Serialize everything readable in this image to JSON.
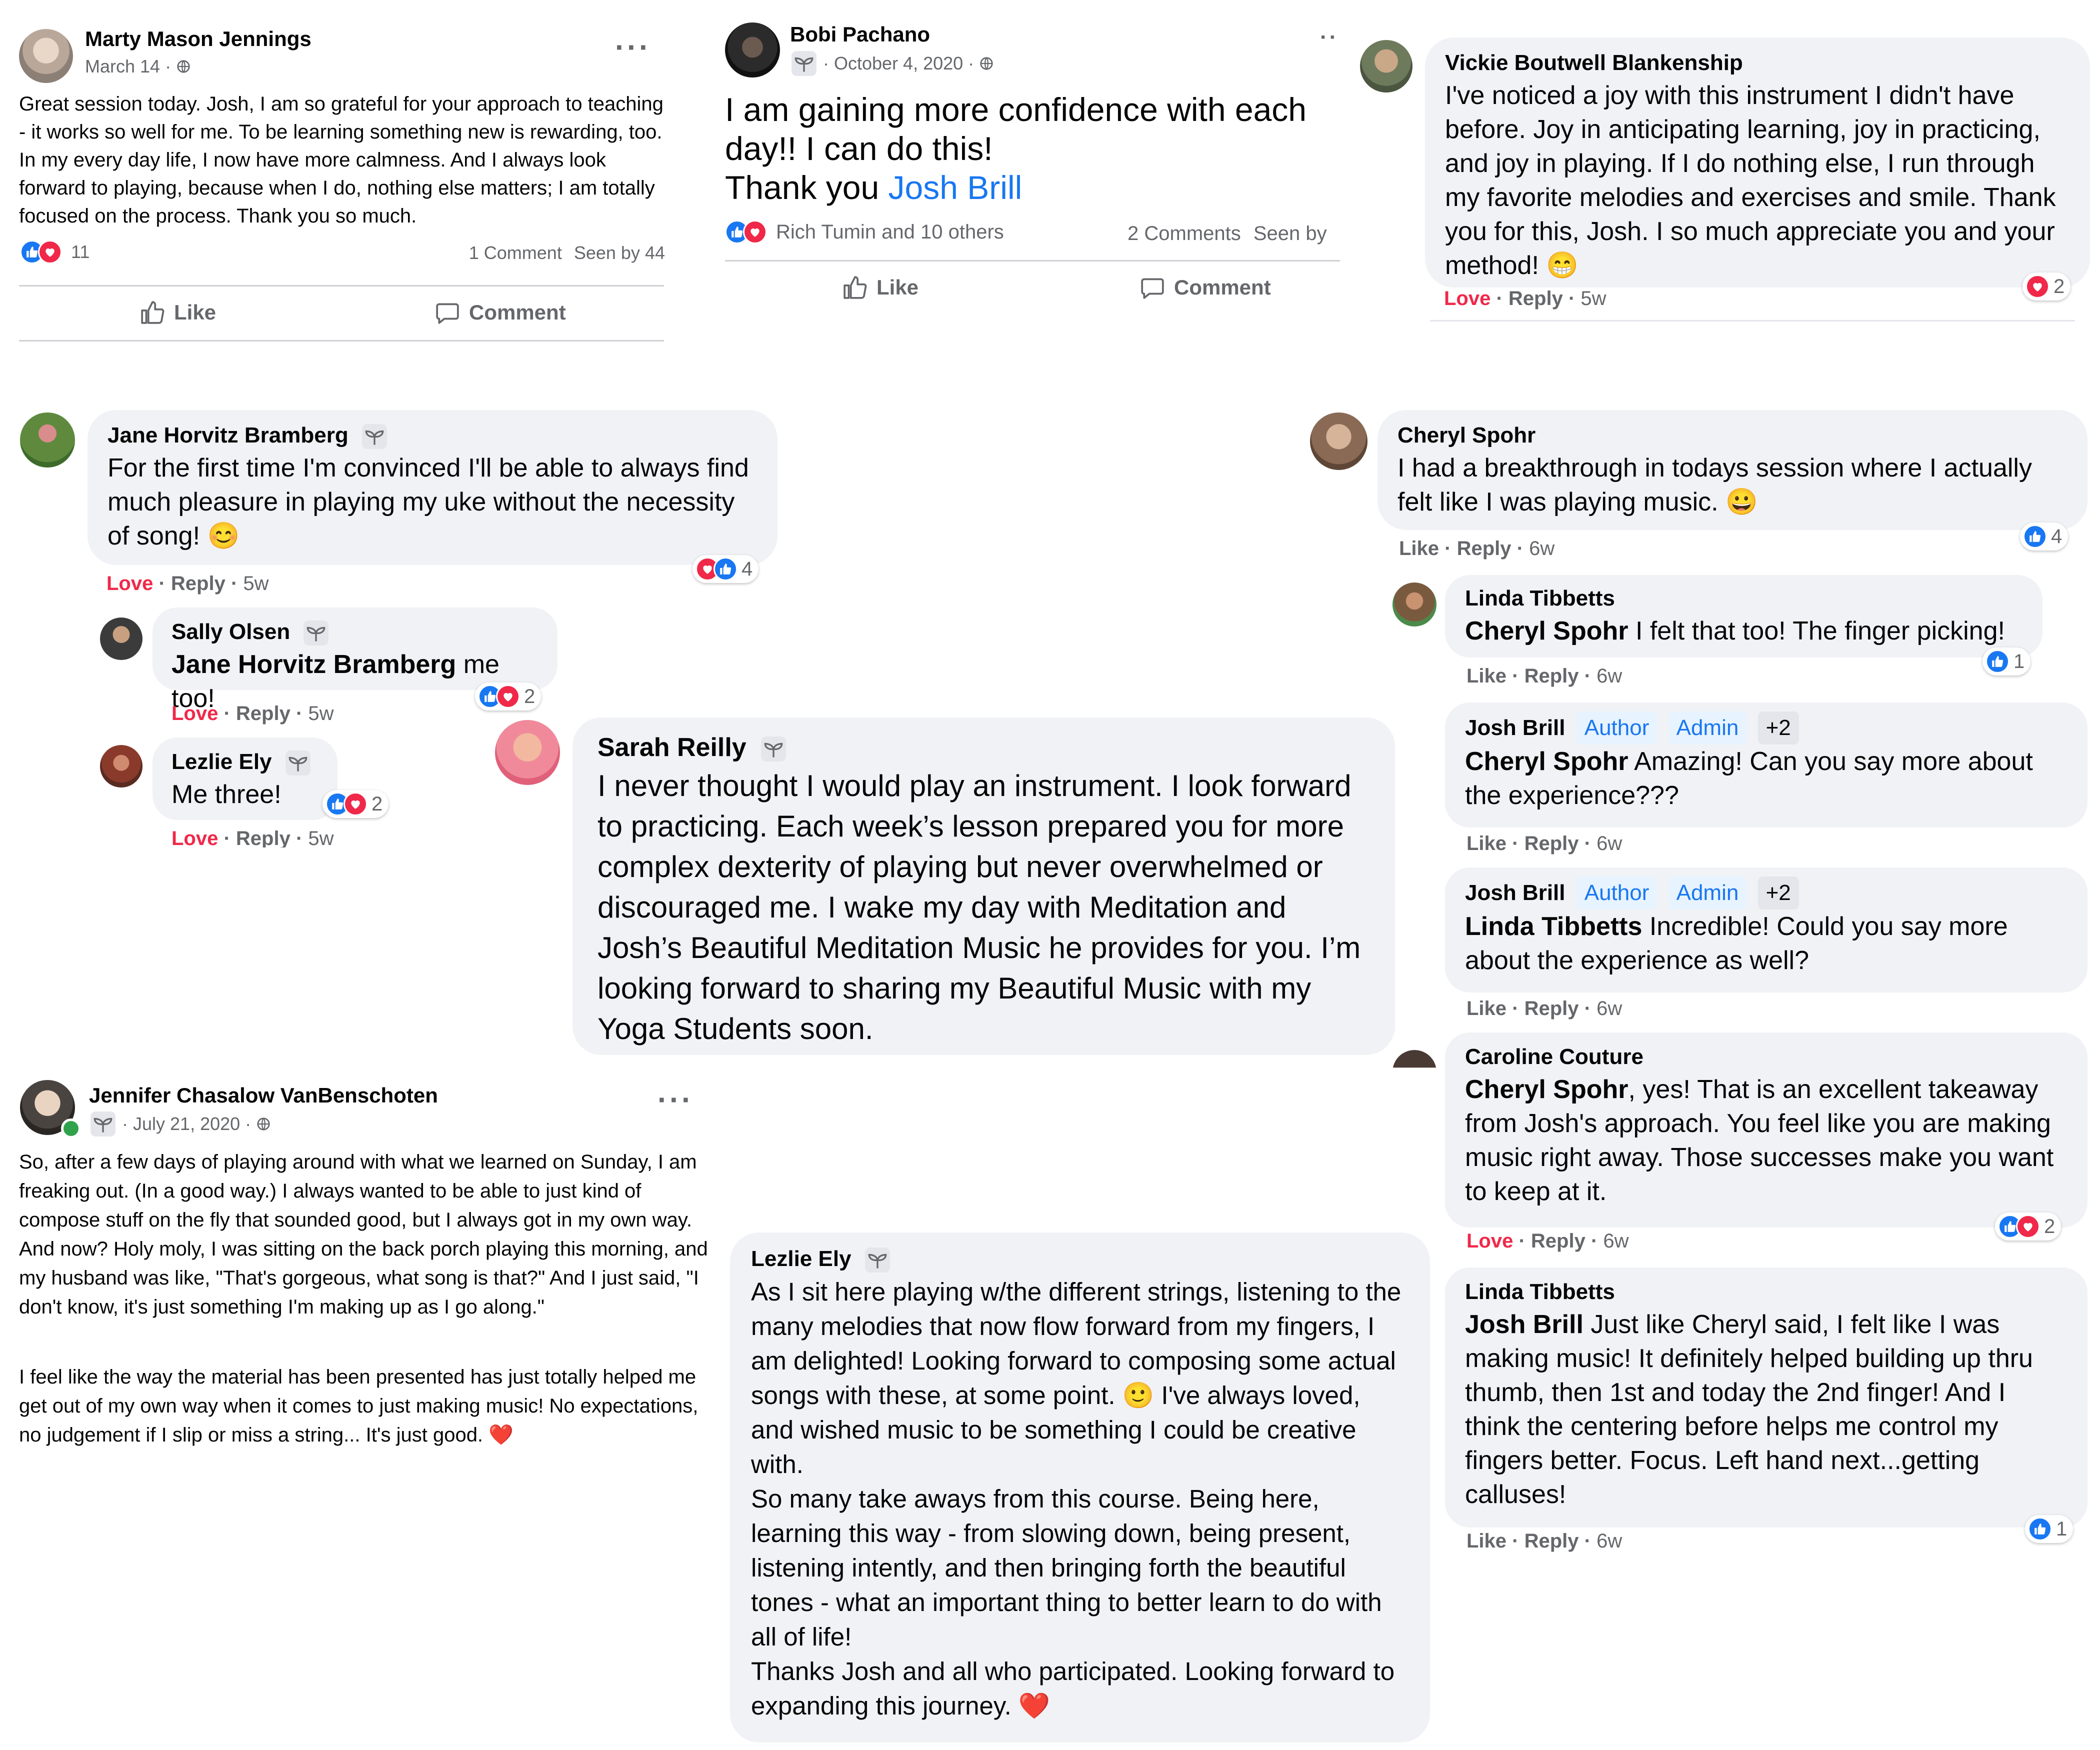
{
  "colors": {
    "like_blue": "#1877f2",
    "love_red": "#f02849",
    "bubble_gray": "#f0f2f5",
    "meta_gray": "#65676b"
  },
  "post_marty": {
    "author": "Marty Mason Jennings",
    "date": "March 14",
    "text": "Great session today. Josh, I am so grateful for your approach to teaching - it works so well for me. To be learning something new is rewarding, too. In my every day life, I now have more calmness. And I always look forward to playing, because when I do, nothing else matters; I am totally focused on the process. Thank you so much.",
    "reaction_count": "11",
    "comments": "1 Comment",
    "seen": "Seen by 44",
    "like_label": "Like",
    "comment_label": "Comment"
  },
  "post_bobi": {
    "author": "Bobi Pachano",
    "date": "October 4, 2020",
    "text_line1": "I am gaining more confidence with each day!! I can do this!",
    "text_thanks": "Thank you ",
    "text_link": "Josh Brill",
    "reaction_summary": "Rich Tumin and 10 others",
    "comments": "2 Comments",
    "seen": "Seen by",
    "like_label": "Like",
    "comment_label": "Comment"
  },
  "comment_vickie": {
    "author": "Vickie Boutwell Blankenship",
    "text": "I've noticed a joy with this instrument I didn't have before. Joy in anticipating learning, joy in practicing, and joy in playing. If I do nothing else, I run through my favorite melodies and exercises and smile. Thank you for this, Josh. I so much appreciate you and your method! 😁",
    "action_react": "Love",
    "action_reply": "Reply",
    "time": "5w",
    "reaction_count": "2"
  },
  "comment_jane": {
    "author": "Jane Horvitz Bramberg",
    "text": "For the first time I'm convinced I'll be able to always find much pleasure in playing my uke without the necessity of song! 😊",
    "action_react": "Love",
    "action_reply": "Reply",
    "time": "5w",
    "reaction_count": "4"
  },
  "reply_sally": {
    "author": "Sally Olsen",
    "mention": "Jane Horvitz Bramberg",
    "text": " me too!",
    "action_react": "Love",
    "action_reply": "Reply",
    "time": "5w",
    "reaction_count": "2"
  },
  "reply_lezlie_small": {
    "author": "Lezlie Ely",
    "text": "Me three!",
    "action_react": "Love",
    "action_reply": "Reply",
    "time": "5w",
    "reaction_count": "2"
  },
  "comment_sarah": {
    "author": "Sarah Reilly",
    "text": "I never thought I would play an instrument. I look forward to practicing. Each week’s lesson prepared you for more complex dexterity of playing but never overwhelmed or discouraged me. I wake my day with Meditation and Josh’s Beautiful Meditation Music he provides for you. I’m looking forward to sharing my Beautiful Music with my Yoga Students soon."
  },
  "post_jennifer": {
    "author": "Jennifer Chasalow VanBenschoten",
    "date": "July 21, 2020",
    "para1": "So, after a few days of playing around with what we learned on Sunday, I am freaking out. (In a good way.) I always wanted to be able to just kind of compose stuff on the fly that sounded good, but I always got in my own way. And now? Holy moly, I was sitting on the back porch playing this morning, and my husband was like, \"That's gorgeous, what song is that?\" And I just said, \"I don't know, it's just something I'm making up as I go along.\"",
    "para2": "I feel like the way the material has been presented has just totally helped me get out of my own way when it comes to just making music! No expectations, no judgement if I slip or miss a string... It's just good. ❤️"
  },
  "comment_lezlie": {
    "author": "Lezlie Ely",
    "text": "As I sit here playing w/the different strings, listening to the many melodies that now flow forward from my fingers, I am delighted! Looking forward to composing some actual songs with these, at some point. 🙂 I've always loved, and wished music to be something I could be creative with.\nSo many take aways from this course. Being here, learning this way - from slowing down, being present, listening intently, and then bringing forth the beautiful tones - what an important thing to better learn to do with all of life!\nThanks Josh and all who participated. Looking forward to expanding this journey. ❤️"
  },
  "comment_cheryl": {
    "author": "Cheryl Spohr",
    "text": "I had a breakthrough in todays session where I actually felt like I was playing music. 😀",
    "action_like": "Like",
    "action_reply": "Reply",
    "time": "6w",
    "reaction_count": "4"
  },
  "reply_linda1": {
    "author": "Linda Tibbetts",
    "mention": "Cheryl Spohr",
    "text": " I felt that too! The finger picking!",
    "action_like": "Like",
    "action_reply": "Reply",
    "time": "6w",
    "reaction_count": "1"
  },
  "reply_josh1": {
    "author": "Josh Brill",
    "badge_author": "Author",
    "badge_admin": "Admin",
    "badge_more": "+2",
    "mention": "Cheryl Spohr",
    "text": " Amazing! Can you say more about the experience???",
    "action_like": "Like",
    "action_reply": "Reply",
    "time": "6w"
  },
  "reply_josh2": {
    "author": "Josh Brill",
    "badge_author": "Author",
    "badge_admin": "Admin",
    "badge_more": "+2",
    "mention": "Linda Tibbetts",
    "text": " Incredible! Could you say more about the experience as well?",
    "action_like": "Like",
    "action_reply": "Reply",
    "time": "6w"
  },
  "reply_caroline": {
    "author": "Caroline Couture",
    "mention": "Cheryl Spohr",
    "text": ", yes! That is an excellent takeaway from Josh's approach. You feel like you are making music right away. Those successes make you want to keep at it.",
    "action_react": "Love",
    "action_reply": "Reply",
    "time": "6w",
    "reaction_count": "2"
  },
  "reply_linda2": {
    "author": "Linda Tibbetts",
    "mention": "Josh Brill",
    "text": " Just like Cheryl said, I felt like I was making music! It definitely helped building up thru thumb, then 1st and today the 2nd finger! And I think the centering before helps me control my fingers better. Focus. Left hand next...getting calluses!",
    "action_like": "Like",
    "action_reply": "Reply",
    "time": "6w",
    "reaction_count": "1"
  }
}
